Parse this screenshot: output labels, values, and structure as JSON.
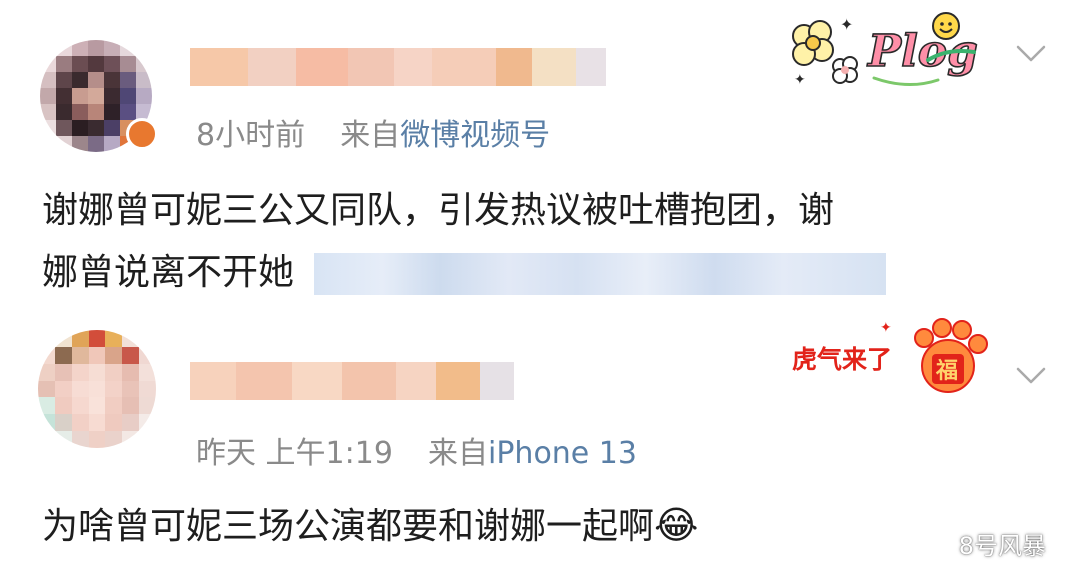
{
  "posts": [
    {
      "time": "8小时前",
      "from_label": "来自",
      "source": "微博视频号",
      "text_line1": "谢娜曾可妮三公又同队，引发热议被吐槽抱团，谢",
      "text_line2": "娜曾说离不开她",
      "decoration": "Plog",
      "menu_icon": "chevron-down-icon"
    },
    {
      "time": "昨天 上午1:19",
      "from_label": "来自",
      "source": "iPhone 13",
      "text": "为啥曾可妮三场公演都要和谢娜一起啊",
      "emoji": "😂",
      "decoration": "虎气来了",
      "decoration_badge": "福",
      "menu_icon": "chevron-down-icon"
    }
  ],
  "watermark": "8号风暴",
  "colors": {
    "link": "#5a7fa6",
    "meta": "#8a8a8a",
    "text": "#1e1e1e"
  }
}
